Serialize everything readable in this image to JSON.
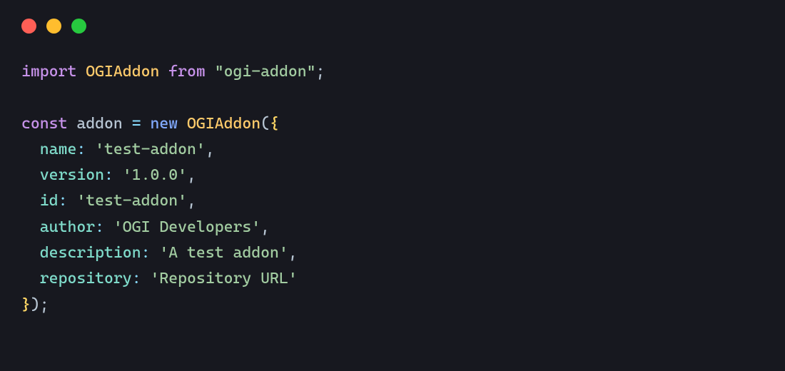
{
  "window": {
    "traffic_lights": {
      "close": "close",
      "minimize": "minimize",
      "zoom": "zoom"
    }
  },
  "code": {
    "kw_import": "import",
    "import_ident": "OGIAddon",
    "kw_from": "from",
    "import_src": "\"ogi-addon\"",
    "semi1": ";",
    "kw_const": "const",
    "var_name": "addon",
    "eq": "=",
    "kw_new": "new",
    "ctor": "OGIAddon",
    "open_paren": "(",
    "open_brace": "{",
    "props": [
      {
        "key": "name",
        "value": "'test-addon'",
        "trailing_comma": true
      },
      {
        "key": "version",
        "value": "'1.0.0'",
        "trailing_comma": true
      },
      {
        "key": "id",
        "value": "'test-addon'",
        "trailing_comma": true
      },
      {
        "key": "author",
        "value": "'OGI Developers'",
        "trailing_comma": true
      },
      {
        "key": "description",
        "value": "'A test addon'",
        "trailing_comma": true
      },
      {
        "key": "repository",
        "value": "'Repository URL'",
        "trailing_comma": false
      }
    ],
    "close_brace": "}",
    "close_paren": ")",
    "semi2": ";"
  }
}
